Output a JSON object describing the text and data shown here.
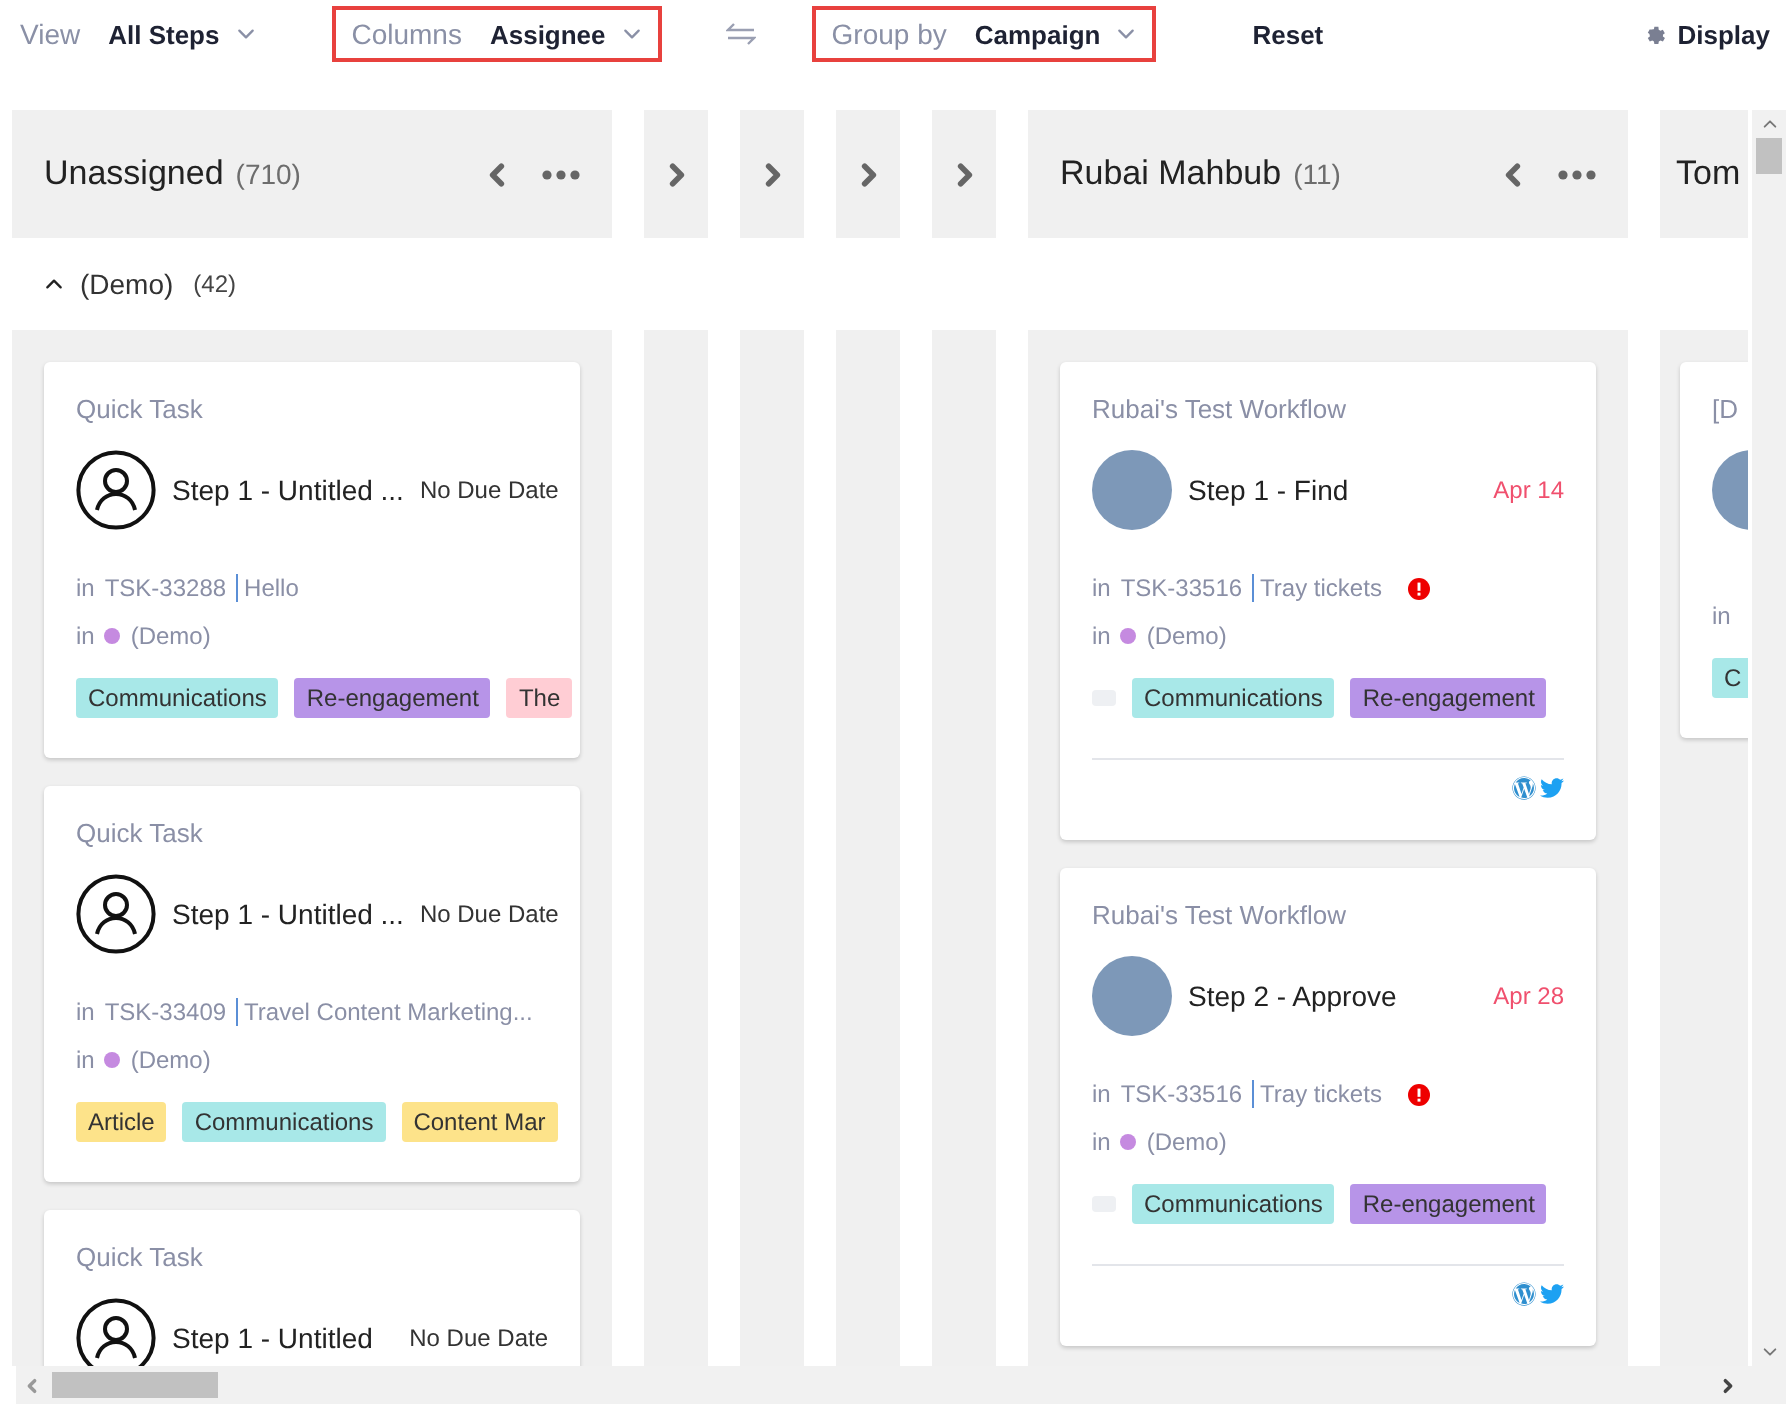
{
  "toolbar": {
    "view": {
      "label": "View",
      "value": "All Steps",
      "highlighted": false
    },
    "columns": {
      "label": "Columns",
      "value": "Assignee",
      "highlighted": true
    },
    "group_by": {
      "label": "Group by",
      "value": "Campaign",
      "highlighted": true
    },
    "reset": "Reset",
    "display": "Display"
  },
  "group": {
    "label": "(Demo)",
    "count": "(42)",
    "expanded": true
  },
  "columns": [
    {
      "collapsed": false,
      "narrow": false,
      "name": "Unassigned",
      "count": "(710)",
      "cards": [
        {
          "category": "Quick Task",
          "avatar": {
            "kind": "none"
          },
          "title": "Step 1 - Untitled ...",
          "due": "No Due Date",
          "overdue": false,
          "task_line": {
            "prefix": "in",
            "id": "TSK-33288",
            "name": "Hello",
            "alert": false
          },
          "project_line": {
            "prefix": "in",
            "name": "(Demo)",
            "color": "#c58ae0"
          },
          "blank_chip": false,
          "tags": [
            {
              "label": "Communications",
              "color": "#a8e8e8"
            },
            {
              "label": "Re-engagement",
              "color": "#b794e8"
            },
            {
              "label": "The",
              "color": "#ffcdd4"
            }
          ]
        },
        {
          "category": "Quick Task",
          "avatar": {
            "kind": "none"
          },
          "title": "Step 1 - Untitled ...",
          "due": "No Due Date",
          "overdue": false,
          "task_line": {
            "prefix": "in",
            "id": "TSK-33409",
            "name": "Travel Content Marketing...",
            "alert": false
          },
          "project_line": {
            "prefix": "in",
            "name": "(Demo)",
            "color": "#c58ae0"
          },
          "blank_chip": false,
          "tags": [
            {
              "label": "Article",
              "color": "#fde38a"
            },
            {
              "label": "Communications",
              "color": "#a8e8e8"
            },
            {
              "label": "Content Mar",
              "color": "#fde38a"
            }
          ]
        },
        {
          "category": "Quick Task",
          "avatar": {
            "kind": "none"
          },
          "title": "Step 1 - Untitled",
          "due": "No Due Date",
          "overdue": false
        }
      ]
    },
    {
      "collapsed": true
    },
    {
      "collapsed": true
    },
    {
      "collapsed": true
    },
    {
      "collapsed": true
    },
    {
      "collapsed": false,
      "narrow": false,
      "name": "Rubai Mahbub",
      "count": "(11)",
      "cards": [
        {
          "category": "Rubai's Test Workflow",
          "avatar": {
            "kind": "photo"
          },
          "title": "Step 1 - Find",
          "due": "Apr 14",
          "overdue": true,
          "task_line": {
            "prefix": "in",
            "id": "TSK-33516",
            "name": "Tray tickets",
            "alert": true
          },
          "project_line": {
            "prefix": "in",
            "name": "(Demo)",
            "color": "#c58ae0"
          },
          "blank_chip": true,
          "tags": [
            {
              "label": "Communications",
              "color": "#a8e8e8"
            },
            {
              "label": "Re-engagement",
              "color": "#b794e8"
            }
          ],
          "channels": [
            {
              "kind": "wordpress"
            },
            {
              "kind": "twitter"
            }
          ]
        },
        {
          "category": "Rubai's Test Workflow",
          "avatar": {
            "kind": "photo"
          },
          "title": "Step 2 - Approve",
          "due": "Apr 28",
          "overdue": true,
          "task_line": {
            "prefix": "in",
            "id": "TSK-33516",
            "name": "Tray tickets",
            "alert": true
          },
          "project_line": {
            "prefix": "in",
            "name": "(Demo)",
            "color": "#c58ae0"
          },
          "blank_chip": true,
          "tags": [
            {
              "label": "Communications",
              "color": "#a8e8e8"
            },
            {
              "label": "Re-engagement",
              "color": "#b794e8"
            }
          ],
          "channels": [
            {
              "kind": "wordpress"
            },
            {
              "kind": "twitter"
            }
          ]
        }
      ]
    },
    {
      "collapsed": false,
      "name": "Tom",
      "narrow": true,
      "cards": [
        {
          "category": "[D",
          "avatar": {
            "kind": "photo"
          },
          "project_line": {
            "prefix": "in"
          },
          "blank_chip": false,
          "tags": [
            {
              "label": "C",
              "color": "#a8e8e8"
            }
          ]
        }
      ]
    }
  ]
}
